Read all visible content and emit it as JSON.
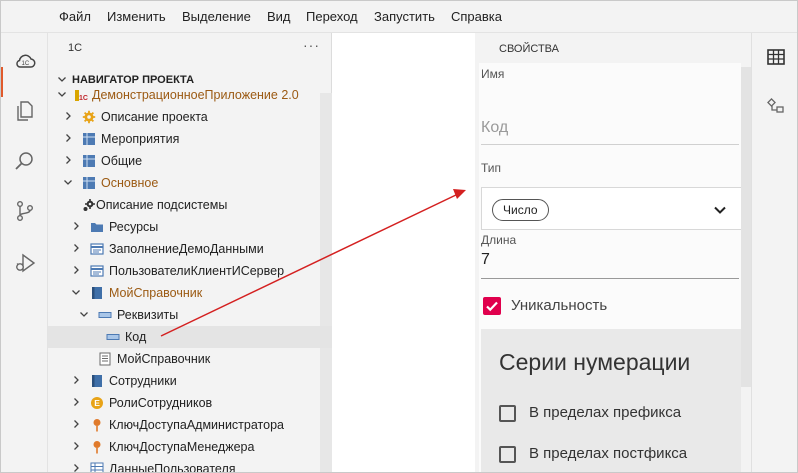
{
  "menu": [
    "Файл",
    "Изменить",
    "Выделение",
    "Вид",
    "Переход",
    "Запустить",
    "Справка"
  ],
  "explorer": {
    "title": "1С",
    "more": "···",
    "section": "НАВИГАТОР ПРОЕКТА",
    "items": [
      {
        "label": "ДемонстрационноеПриложение 2.0",
        "icon": "app-1c-icon",
        "highlight": true
      },
      {
        "label": "Описание проекта",
        "icon": "gear-icon"
      },
      {
        "label": "Мероприятия",
        "icon": "grid-icon"
      },
      {
        "label": "Общие",
        "icon": "grid-icon"
      },
      {
        "label": "Основное",
        "icon": "grid-icon",
        "highlight": true
      },
      {
        "label": "Описание подсистемы",
        "icon": "settings-gear-icon"
      },
      {
        "label": "Ресурсы",
        "icon": "folder-icon"
      },
      {
        "label": "ЗаполнениеДемоДанными",
        "icon": "module-icon"
      },
      {
        "label": "ПользователиКлиентИСервер",
        "icon": "module-icon"
      },
      {
        "label": "МойСправочник",
        "icon": "catalog-icon",
        "highlight": true
      },
      {
        "label": "Реквизиты",
        "icon": "attribute-icon"
      },
      {
        "label": "Код",
        "icon": "attribute-icon"
      },
      {
        "label": "МойСправочник",
        "icon": "form-icon"
      },
      {
        "label": "Сотрудники",
        "icon": "catalog-icon"
      },
      {
        "label": "РолиСотрудников",
        "icon": "enum-icon"
      },
      {
        "label": "КлючДоступаАдминистратора",
        "icon": "key-pin-icon"
      },
      {
        "label": "КлючДоступаМенеджера",
        "icon": "key-pin-icon"
      },
      {
        "label": "ДанныеПользователя",
        "icon": "register-icon"
      }
    ]
  },
  "properties": {
    "title": "СВОЙСТВА",
    "name_label": "Имя",
    "name_placeholder": "Код",
    "type_label": "Тип",
    "type_value": "Число",
    "length_label": "Длина",
    "length_value": "7",
    "unique_label": "Уникальность",
    "unique_checked": true,
    "series_title": "Серии нумерации",
    "series_options": [
      {
        "label": "В пределах префикса",
        "checked": false
      },
      {
        "label": "В пределах постфикса",
        "checked": false
      }
    ]
  },
  "colors": {
    "accent": "#e0004d",
    "highlight_text": "#9b5a13",
    "arrow": "#d42020",
    "active_marker": "#e05a2b"
  }
}
